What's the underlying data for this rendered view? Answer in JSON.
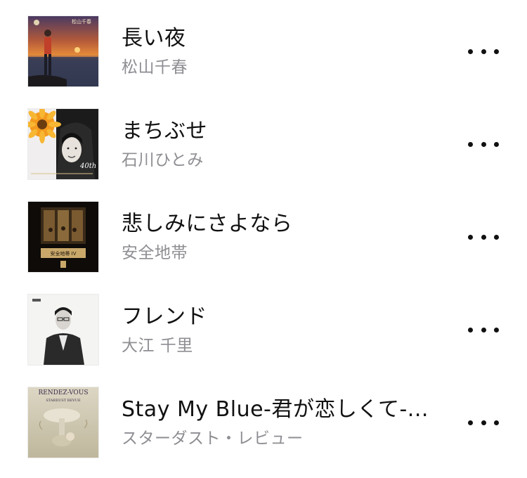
{
  "songs": [
    {
      "title": "長い夜",
      "artist": "松山千春",
      "artwork_icon": "album-artwork-sunset-man",
      "artwork_text": "松山千春"
    },
    {
      "title": "まちぶせ",
      "artist": "石川ひとみ",
      "artwork_icon": "album-artwork-flower-portrait",
      "artwork_text": "40th"
    },
    {
      "title": "悲しみにさよなら",
      "artist": "安全地帯",
      "artwork_icon": "album-artwork-dark-room",
      "artwork_text": "安全地帯 IV"
    },
    {
      "title": "フレンド",
      "artist": "大江 千里",
      "artwork_icon": "album-artwork-bw-portrait",
      "artwork_text": ""
    },
    {
      "title": "Stay My Blue-君が恋しくて-...",
      "artist": "スターダスト・レビュー",
      "artwork_icon": "album-artwork-rendez-vous",
      "artwork_text": "RENDEZ-VOUS",
      "artwork_subtext": "STARDUST REVUE"
    }
  ],
  "more_button": {
    "icon": "ellipsis-icon"
  },
  "colors": {
    "title": "#111111",
    "artist": "#8e8e93",
    "background": "#ffffff"
  }
}
